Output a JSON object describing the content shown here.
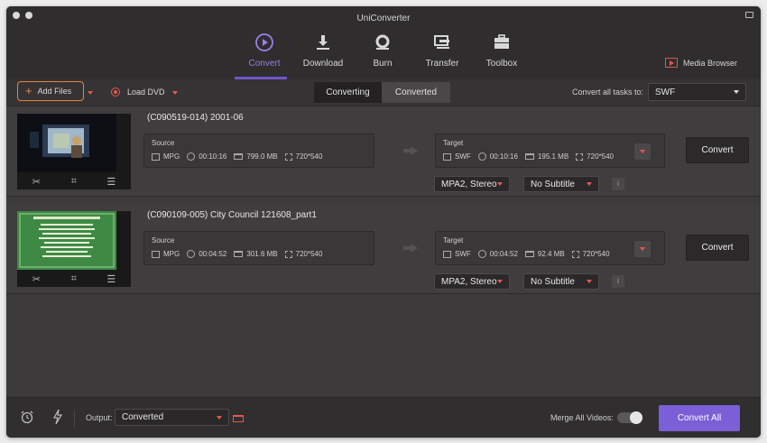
{
  "window": {
    "title": "UniConverter"
  },
  "nav": {
    "tabs": [
      {
        "label": "Convert",
        "icon": "convert-icon",
        "active": true
      },
      {
        "label": "Download",
        "icon": "download-icon",
        "active": false
      },
      {
        "label": "Burn",
        "icon": "burn-icon",
        "active": false
      },
      {
        "label": "Transfer",
        "icon": "transfer-icon",
        "active": false
      },
      {
        "label": "Toolbox",
        "icon": "toolbox-icon",
        "active": false
      }
    ],
    "media_browser": "Media Browser"
  },
  "toolbar": {
    "add_files": "Add Files",
    "load_dvd": "Load DVD",
    "segments": [
      "Converting",
      "Converted"
    ],
    "convert_all_label": "Convert all tasks to:",
    "convert_all_format": "SWF"
  },
  "tasks": [
    {
      "name": "(C090519-014)  2001-06",
      "source": {
        "label": "Source",
        "format": "MPG",
        "duration": "00:10:16",
        "size": "799.0 MB",
        "resolution": "720*540"
      },
      "target": {
        "label": "Target",
        "format": "SWF",
        "duration": "00:10:16",
        "size": "195.1 MB",
        "resolution": "720*540"
      },
      "audio": "MPA2, Stereo",
      "subtitle": "No Subtitle",
      "convert": "Convert"
    },
    {
      "name": "(C090109-005)  City Council 121608_part1",
      "source": {
        "label": "Source",
        "format": "MPG",
        "duration": "00:04:52",
        "size": "301.6 MB",
        "resolution": "720*540"
      },
      "target": {
        "label": "Target",
        "format": "SWF",
        "duration": "00:04:52",
        "size": "92.4 MB",
        "resolution": "720*540"
      },
      "audio": "MPA2, Stereo",
      "subtitle": "No Subtitle",
      "convert": "Convert"
    }
  ],
  "bottom": {
    "output_label": "Output:",
    "output_value": "Converted",
    "merge_label": "Merge All Videos:",
    "merge_on": false,
    "convert_all": "Convert All"
  },
  "colors": {
    "accent": "#7a5fd6",
    "highlight": "#e5853a",
    "red": "#e35a4a"
  }
}
